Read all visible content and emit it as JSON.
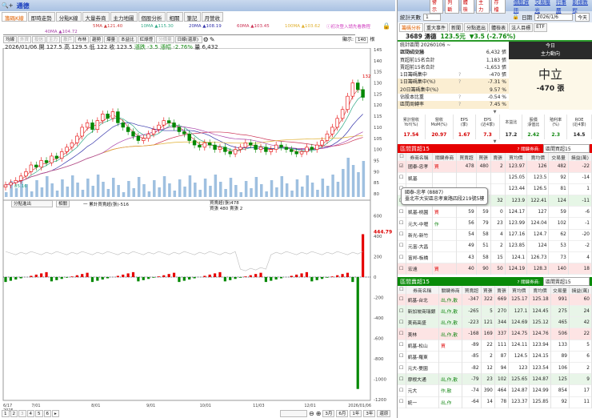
{
  "app": {
    "title": "通德",
    "colors": {
      "up": "#e60000",
      "down": "#008800",
      "buyHeader": "#e60000",
      "sellHeader": "#088a08",
      "accent": "#1a3fbf"
    }
  },
  "tabs": [
    "籌碼K線",
    "即時走勢",
    "分點K線",
    "大量券商",
    "主力地圖",
    "個股分析",
    "相關",
    "筆記",
    "月營收"
  ],
  "ma": [
    {
      "label": "5MA ▲121.40",
      "color": "#d04040"
    },
    {
      "label": "10MA ▲115.30",
      "color": "#33aa88"
    },
    {
      "label": "20MA ▲108.19",
      "color": "#3333aa"
    },
    {
      "label": "60MA ▲103.45",
      "color": "#cc3355"
    },
    {
      "label": "100MA ▲103.62",
      "color": "#e0b030"
    },
    {
      "label": "40MA ▲104.72",
      "color": "#aa44aa"
    }
  ],
  "hint": "ⓘ初次登入請先看教程",
  "toolbar": {
    "buttons": [
      "均線",
      "外資",
      "投信",
      "主力",
      "散戶",
      "布林",
      "趨勢",
      "爆量",
      "本益比",
      "紅綠燈",
      "分價量"
    ],
    "disabled": [
      1,
      2,
      3,
      4,
      10
    ],
    "select": "日線(還原)",
    "show_label": "顯示:",
    "show_value": "140",
    "show_unit": "根"
  },
  "quote": {
    "date": "2026/01/06",
    "open": "開 127.5",
    "high": "高 129.5",
    "low": "低 122",
    "close": "收 123.5",
    "change": "漲跌 -3.5",
    "pct": "漲幅 -2.76%",
    "vol": "量 6,432"
  },
  "price_axis": [
    "145",
    "140",
    "135",
    "130",
    "125",
    "120",
    "115",
    "110",
    "105",
    "100",
    "95",
    "90",
    "85",
    "80"
  ],
  "high_label": "132",
  "low_label": "85.16",
  "lower": {
    "select": "分點進出",
    "button": "相關",
    "legend1": "一 累計買賣超(張)-516",
    "legend2": "買賣超(張)478",
    "legend3": "買張 480 賣張 2",
    "value": "444.79",
    "axis": [
      "600",
      "400",
      "200",
      "0",
      "-200",
      "-400",
      "-600",
      "-800",
      "-1000",
      "-1200"
    ]
  },
  "x_labels": [
    "6/17\n2025",
    "7/01",
    "8/01",
    "9/01",
    "10/01",
    "11/03",
    "12/01",
    "2026/01/06"
  ],
  "pages": [
    "1",
    "2",
    "3",
    "4",
    "5",
    "6",
    "▸"
  ],
  "ranges": [
    "3月",
    "6月",
    "1年",
    "3年",
    "還原"
  ],
  "closes": [
    84,
    85,
    86,
    88,
    90,
    93,
    92,
    95,
    94,
    97,
    96,
    99,
    101,
    103,
    106,
    110,
    112,
    109,
    113,
    116,
    114,
    117,
    112,
    110,
    108,
    106,
    104,
    105,
    107,
    109,
    111,
    113,
    112,
    110,
    108,
    107,
    104,
    102,
    101,
    103,
    102,
    100,
    101,
    99,
    98,
    100,
    101,
    103,
    102,
    100,
    101,
    99,
    100,
    102,
    101,
    100,
    99,
    98,
    99,
    101,
    100,
    102,
    104,
    107,
    110,
    114,
    118,
    124,
    130,
    127,
    123.5
  ],
  "right": {
    "buttons": [
      "警示",
      "判斷",
      "體檢",
      "主力",
      "存檔"
    ],
    "links": [
      "個股資訊",
      "交易曝光",
      "行事曆",
      "影視教程"
    ],
    "days_label": "統計天數",
    "days": "1",
    "date_label": "日期",
    "date": "2026/1/6",
    "today_btn": "今天",
    "tabs": [
      "籌碼分析",
      "重大事件",
      "新聞",
      "分點進出",
      "體檢表",
      "法人目標",
      "ETF"
    ],
    "stock": "3689 湧德",
    "price": "123.5元",
    "change": "▼3.5 (-2.76%)",
    "stats": [
      [
        "統計區間 20260106 ~ 20260106",
        "",
        ""
      ],
      [
        "區間成交量",
        "",
        "6,432 張"
      ],
      [
        "買超前15名合計",
        "",
        "1,183 張"
      ],
      [
        "賣超前15名合計",
        "",
        "-1,653 張"
      ],
      [
        "1日籌碼集中",
        "?",
        "-470 張"
      ],
      [
        "1日籌碼集中(%)",
        "?",
        "-7.31 %"
      ],
      [
        "20日籌碼集中(%)",
        "",
        "9.57 %"
      ],
      [
        "佔股本比重",
        "?",
        "-0.54 %"
      ],
      [
        "區間周轉率",
        "?",
        "7.45 %"
      ]
    ],
    "trend_title1": "今日",
    "trend_title2": "主力動向",
    "trend": "中立",
    "trend_value": "-470 張",
    "fund_heads": [
      "累計營收\nYoY(%)",
      "營收\nMoM(%)",
      "EPS\n(季)",
      "EPS\n(近4季)",
      "本益比",
      "股價\n淨值比",
      "殖利率\n(%)",
      "ROE\n(近4季)"
    ],
    "fund_vals": [
      "17.54",
      "20.97",
      "1.67",
      "7.3",
      "17.2",
      "2.42",
      "2.3",
      "14.5"
    ],
    "buy_title": "區間買超15",
    "sell_title": "區間賣超15",
    "key_label": "? 關鍵券商:",
    "key_select": "區間買超15",
    "key_select2": "區間賣超15",
    "cols": [
      "券商名稱",
      "關鍵券商",
      "買賣超",
      "買張",
      "賣張",
      "買均價",
      "賣均價",
      "交易量",
      "損益(萬)"
    ],
    "buy_rows": [
      [
        "國泰-忠孝",
        "買",
        "478",
        "480",
        "2",
        "123.97",
        "126",
        "482",
        "-22"
      ],
      [
        "凱基",
        "",
        "",
        "",
        "",
        "125.05",
        "123.5",
        "92",
        "-14"
      ],
      [
        "兆豐-松",
        "",
        "",
        "",
        "",
        "123.44",
        "126.5",
        "81",
        "1"
      ],
      [
        "中國信託",
        "買,作,散",
        "60",
        "92",
        "32",
        "123.9",
        "122.41",
        "124",
        "-11"
      ],
      [
        "凱基-桃園",
        "買",
        "59",
        "59",
        "0",
        "124.17",
        "127",
        "59",
        "-6"
      ],
      [
        "元大-中壢",
        "作",
        "56",
        "79",
        "23",
        "123.99",
        "124.04",
        "102",
        "-1"
      ],
      [
        "新光-新竹",
        "",
        "54",
        "58",
        "4",
        "127.16",
        "124.7",
        "62",
        "-20"
      ],
      [
        "元富-大昌",
        "",
        "49",
        "51",
        "2",
        "123.85",
        "124",
        "53",
        "-2"
      ],
      [
        "富邦-板橋",
        "",
        "43",
        "58",
        "15",
        "124.1",
        "126.73",
        "73",
        "4"
      ],
      [
        "宏遠",
        "買",
        "40",
        "90",
        "50",
        "124.19",
        "128.3",
        "140",
        "18"
      ]
    ],
    "tooltip1": "國泰-忠孝 (8887)",
    "tooltip2": "臺北市大安區忠孝東路四段219號5樓",
    "sell_rows": [
      [
        "凱基-台北",
        "出,作,散",
        "-347",
        "322",
        "669",
        "125.17",
        "125.18",
        "991",
        "60"
      ],
      [
        "新加坡商瑞銀",
        "出,作,散",
        "-265",
        "5",
        "270",
        "127.1",
        "124.45",
        "275",
        "24"
      ],
      [
        "美商高盛",
        "出,作,散",
        "-223",
        "121",
        "344",
        "124.69",
        "125.12",
        "465",
        "42"
      ],
      [
        "美林",
        "出,作,散",
        "-168",
        "169",
        "337",
        "124.75",
        "124.76",
        "506",
        "22"
      ],
      [
        "凱基-松山",
        "買",
        "-89",
        "22",
        "111",
        "124.11",
        "123.94",
        "133",
        "5"
      ],
      [
        "凱基-羅東",
        "",
        "-85",
        "2",
        "87",
        "124.5",
        "124.15",
        "89",
        "6"
      ],
      [
        "元大-雙園",
        "",
        "-82",
        "12",
        "94",
        "123",
        "123.54",
        "106",
        "2"
      ],
      [
        "摩根大通",
        "出,作,散",
        "-79",
        "23",
        "102",
        "125.65",
        "124.87",
        "125",
        "9"
      ],
      [
        "元大",
        "作,散",
        "-74",
        "390",
        "464",
        "124.87",
        "124.99",
        "854",
        "17"
      ],
      [
        "統一",
        "出,作",
        "-64",
        "14",
        "78",
        "123.37",
        "125.85",
        "92",
        "11"
      ]
    ]
  }
}
